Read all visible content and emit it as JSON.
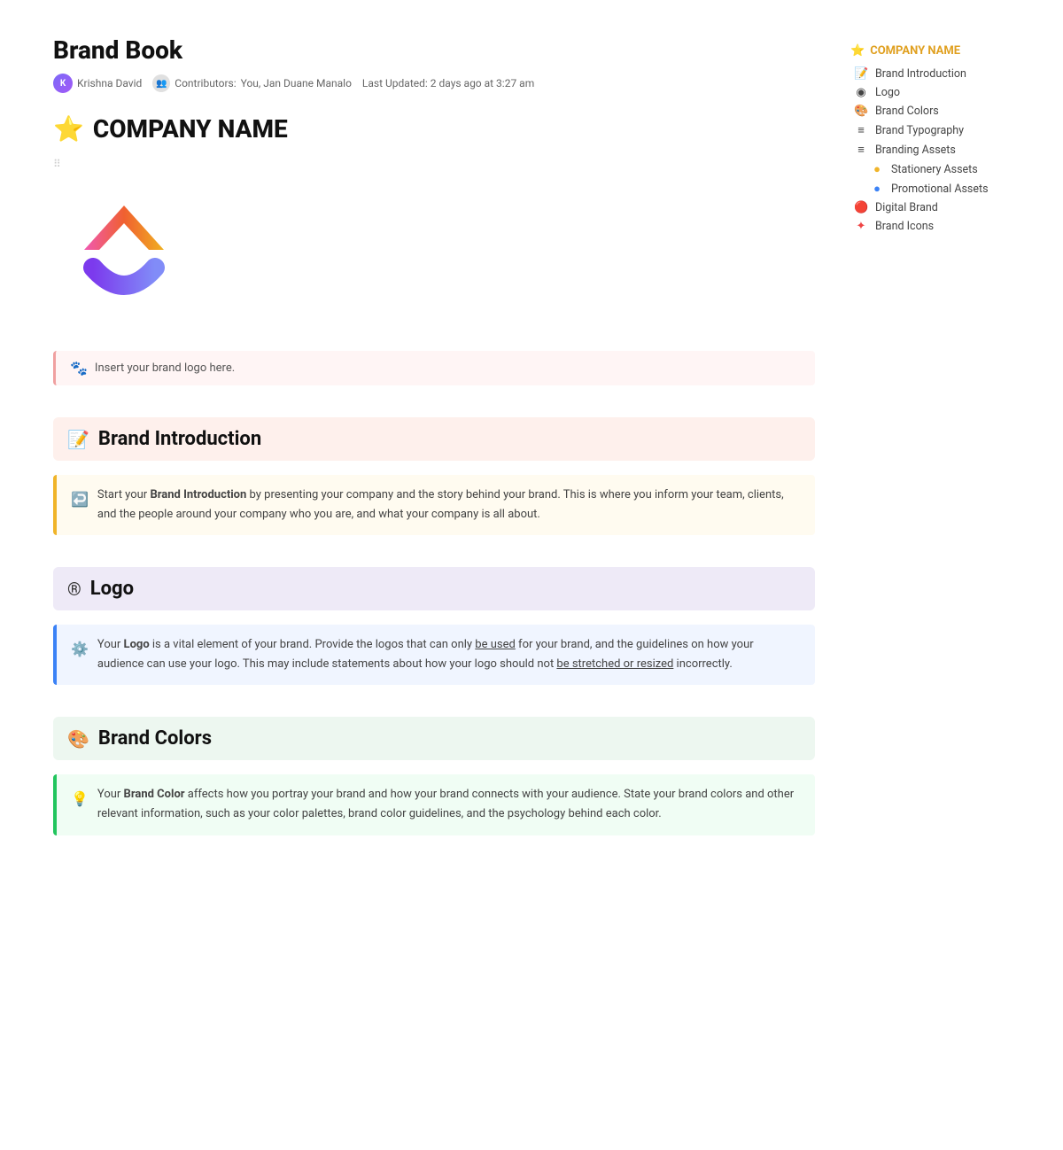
{
  "page": {
    "title": "Brand Book",
    "author": "Krishna David",
    "contributors_label": "Contributors:",
    "contributors": "You, Jan Duane Manalo",
    "last_updated": "Last Updated: 2 days ago at 3:27 am"
  },
  "company": {
    "name": "COMPANY NAME"
  },
  "callout_insert": {
    "text": "Insert your brand logo here.",
    "emoji": "🐾"
  },
  "sections": {
    "brand_introduction": {
      "title": "Brand Introduction",
      "icon": "📝",
      "callout_icon": "↩️",
      "text_start": "Start your ",
      "text_bold": "Brand Introduction",
      "text_end": " by presenting your company and the story behind your brand. This is where you inform your team, clients, and the people around your company who you are, and what your company is all about."
    },
    "logo": {
      "title": "Logo",
      "icon": "®",
      "callout_icon": "⚙️",
      "text_start": "Your ",
      "text_bold": "Logo",
      "text_mid": " is a vital element of your brand. Provide the logos that can only ",
      "text_link1": "be used",
      "text_mid2": " for your brand, and the guidelines on how your audience can use your logo. This may include statements about how your logo should not ",
      "text_link2": "be stretched or resized",
      "text_end": " incorrectly."
    },
    "brand_colors": {
      "title": "Brand Colors",
      "icon": "🎨",
      "callout_icon": "💡",
      "text_start": "Your ",
      "text_bold": "Brand Color",
      "text_end": " affects how you portray your brand and how your brand connects with your audience. State your brand colors and other relevant information, such as your color palettes, brand color guidelines, and the psychology behind each color."
    }
  },
  "sidebar": {
    "top_item": {
      "label": "COMPANY NAME",
      "icon": "⭐"
    },
    "items": [
      {
        "label": "Brand Introduction",
        "icon": "📝",
        "indent": false
      },
      {
        "label": "Logo",
        "icon": "◉",
        "indent": false
      },
      {
        "label": "Brand Colors",
        "icon": "🎨",
        "indent": false
      },
      {
        "label": "Brand Typography",
        "icon": "≡",
        "indent": false
      },
      {
        "label": "Branding Assets",
        "icon": "≡",
        "indent": false
      },
      {
        "label": "Stationery Assets",
        "icon": "🟡",
        "indent": true
      },
      {
        "label": "Promotional Assets",
        "icon": "🔵",
        "indent": true
      },
      {
        "label": "Digital Brand",
        "icon": "🔴",
        "indent": false
      },
      {
        "label": "Brand Icons",
        "icon": "✦",
        "indent": false
      }
    ]
  }
}
